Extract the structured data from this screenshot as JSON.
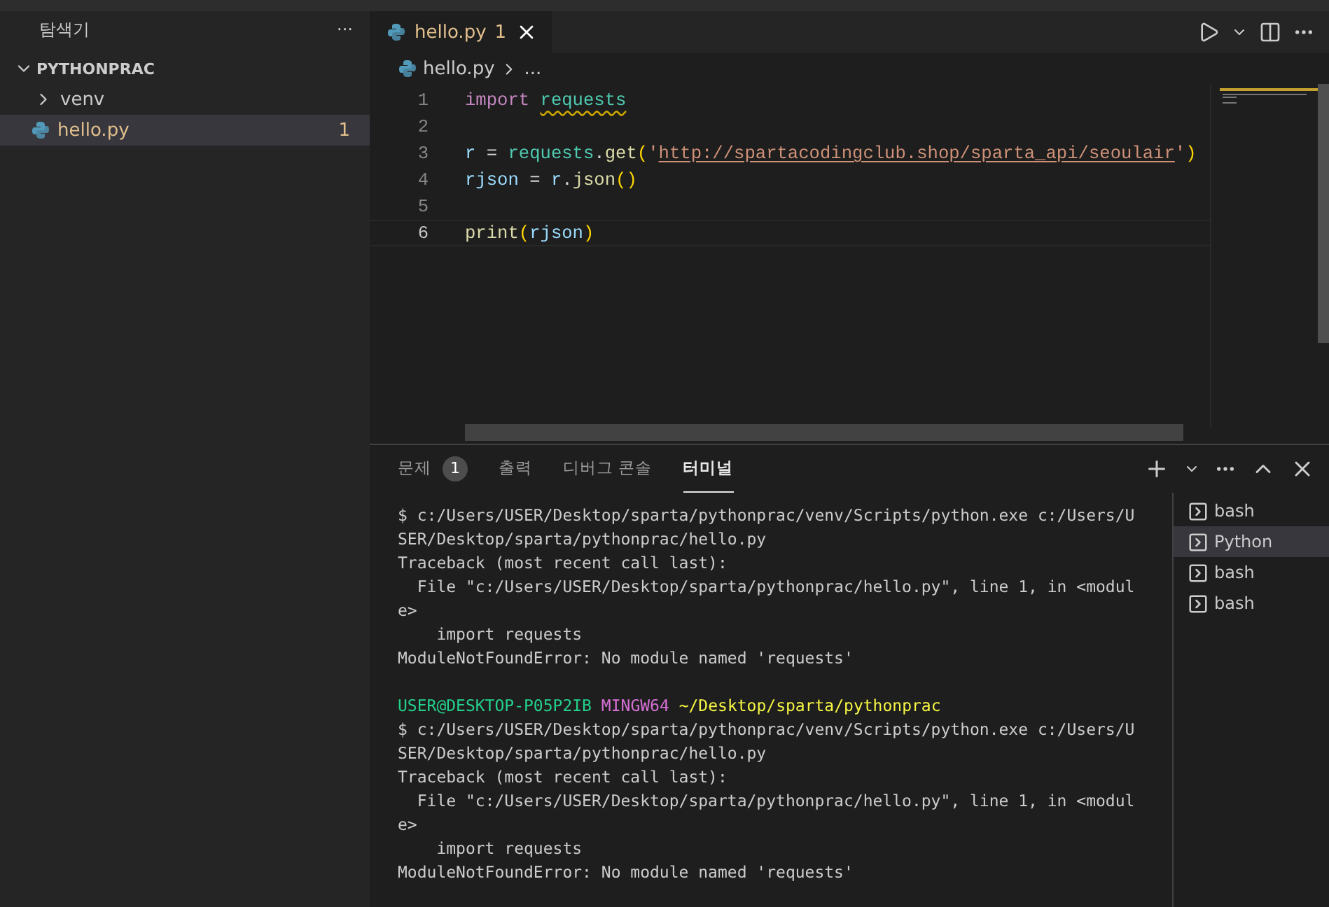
{
  "sidebar": {
    "title": "탐색기",
    "more": "···",
    "folder": {
      "name": "PYTHONPRAC",
      "expanded": true,
      "children": [
        {
          "name": "venv",
          "kind": "folder",
          "expanded": false,
          "selected": false
        },
        {
          "name": "hello.py",
          "kind": "python",
          "problems": "1",
          "selected": true
        }
      ]
    }
  },
  "editor": {
    "tabs": [
      {
        "label": "hello.py",
        "problems": "1",
        "selected": true
      }
    ],
    "breadcrumb": {
      "file": "hello.py",
      "rest": "..."
    },
    "lines": [
      {
        "number": "1",
        "current": false,
        "tokens": [
          {
            "text": "import ",
            "kind": "keyword"
          },
          {
            "text": "requests",
            "kind": "module",
            "squiggle": true
          }
        ]
      },
      {
        "number": "2",
        "current": false
      },
      {
        "number": "3",
        "current": false,
        "tokens": [
          {
            "text": "r",
            "kind": "variable"
          },
          {
            "text": " = ",
            "kind": "plain"
          },
          {
            "text": "requests",
            "kind": "module"
          },
          {
            "text": ".",
            "kind": "plain"
          },
          {
            "text": "get",
            "kind": "function"
          },
          {
            "text": "(",
            "kind": "paren"
          },
          {
            "text": "'",
            "kind": "string"
          },
          {
            "text": "http://spartacodingclub.shop/sparta_api/seoulair",
            "kind": "string",
            "link": true
          },
          {
            "text": "'",
            "kind": "string"
          },
          {
            "text": ")",
            "kind": "paren"
          }
        ]
      },
      {
        "number": "4",
        "current": false,
        "tokens": [
          {
            "text": "rjson",
            "kind": "variable"
          },
          {
            "text": " = ",
            "kind": "plain"
          },
          {
            "text": "r",
            "kind": "variable"
          },
          {
            "text": ".",
            "kind": "plain"
          },
          {
            "text": "json",
            "kind": "function"
          },
          {
            "text": "()",
            "kind": "paren"
          }
        ]
      },
      {
        "number": "5",
        "current": false
      },
      {
        "number": "6",
        "current": true,
        "tokens": [
          {
            "text": "print",
            "kind": "function"
          },
          {
            "text": "(",
            "kind": "paren"
          },
          {
            "text": "rjson",
            "kind": "variable"
          },
          {
            "text": ")",
            "kind": "paren"
          }
        ]
      }
    ]
  },
  "panel": {
    "tabs": [
      {
        "label": "문제",
        "badge": "1",
        "selected": false
      },
      {
        "label": "출력",
        "selected": false
      },
      {
        "label": "디버그 콘솔",
        "selected": false
      },
      {
        "label": "터미널",
        "selected": true
      }
    ],
    "terminal_lines": [
      {
        "kind": "plain",
        "text": "$ c:/Users/USER/Desktop/sparta/pythonprac/venv/Scripts/python.exe c:/Users/U"
      },
      {
        "kind": "plain",
        "text": "SER/Desktop/sparta/pythonprac/hello.py"
      },
      {
        "kind": "plain",
        "text": "Traceback (most recent call last):"
      },
      {
        "kind": "plain",
        "text": "  File \"c:/Users/USER/Desktop/sparta/pythonprac/hello.py\", line 1, in <modul"
      },
      {
        "kind": "plain",
        "text": "e>"
      },
      {
        "kind": "plain",
        "text": "    import requests"
      },
      {
        "kind": "plain",
        "text": "ModuleNotFoundError: No module named 'requests'"
      },
      {
        "kind": "blank"
      },
      {
        "kind": "prompt",
        "user": "USER@DESKTOP-P05P2IB",
        "system": "MINGW64",
        "path": "~/Desktop/sparta/pythonprac"
      },
      {
        "kind": "plain",
        "text": "$ c:/Users/USER/Desktop/sparta/pythonprac/venv/Scripts/python.exe c:/Users/U"
      },
      {
        "kind": "plain",
        "text": "SER/Desktop/sparta/pythonprac/hello.py"
      },
      {
        "kind": "plain",
        "text": "Traceback (most recent call last):"
      },
      {
        "kind": "plain",
        "text": "  File \"c:/Users/USER/Desktop/sparta/pythonprac/hello.py\", line 1, in <modul"
      },
      {
        "kind": "plain",
        "text": "e>"
      },
      {
        "kind": "plain",
        "text": "    import requests"
      },
      {
        "kind": "plain",
        "text": "ModuleNotFoundError: No module named 'requests'"
      }
    ],
    "terminals": [
      {
        "name": "bash",
        "selected": false
      },
      {
        "name": "Python",
        "selected": true
      },
      {
        "name": "bash",
        "selected": false
      },
      {
        "name": "bash",
        "selected": false
      }
    ]
  }
}
